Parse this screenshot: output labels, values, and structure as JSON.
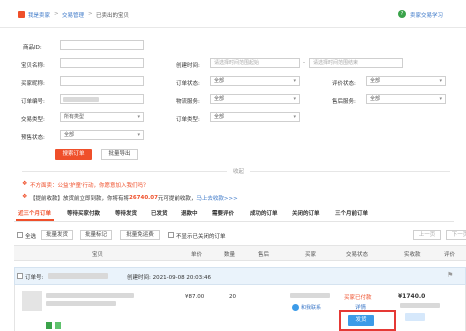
{
  "breadcrumb": {
    "home": "我是卖家",
    "section": "交易管理",
    "current": "已卖出的宝贝",
    "help": "卖家交易学习"
  },
  "filters": {
    "product_name_label": "商品ID:",
    "product_id_label": "宝贝名称:",
    "buyer_nick_label": "买家昵称:",
    "order_no_label": "订单编号:",
    "trade_type_label": "交易类型:",
    "trade_type_value": "所有类型",
    "presale_label": "预售状态:",
    "presale_value": "全部",
    "created_time_label": "创建时间:",
    "created_time_start_placeholder": "请选择时间范围起始",
    "created_time_end_placeholder": "请选择时间范围结束",
    "order_status_label": "订单状态:",
    "order_status_value": "全部",
    "logistics_label": "物流服务:",
    "logistics_value": "全部",
    "order_type_label": "订单类型:",
    "order_type_value": "全部",
    "review_status_label": "评价状态:",
    "review_status_value": "全部",
    "after_sale_label": "售后服务:",
    "after_sale_value": "全部",
    "search_button": "搜索订单",
    "export_button": "批量导出",
    "collapse": "收起"
  },
  "notices": {
    "line1": "不方面卖：公益'护童'行动，你愿意加入我们吗？",
    "line2_prefix": "【提前收款】放货前立即到款，你将有将",
    "line2_amount": "26740.07",
    "line2_suffix": "元可提前收款，",
    "line2_link": "马上去收款>>>"
  },
  "tabs": [
    "近三个月订单",
    "等待买家付款",
    "等待发货",
    "已发货",
    "退款中",
    "需要评价",
    "成功的订单",
    "关闭的订单",
    "三个月前订单"
  ],
  "bulk": {
    "select_all": "全选",
    "batch_ship": "批量发货",
    "batch_mark": "批量标记",
    "batch_free": "批量免运费",
    "hide_closed": "不显示已关闭的订单",
    "prev_page": "上一页",
    "next_page": "下一页"
  },
  "table": {
    "headers": [
      "宝贝",
      "单价",
      "数量",
      "售后",
      "买家",
      "交易状态",
      "实收款",
      "评价"
    ]
  },
  "order": {
    "order_label": "订单号:",
    "created_label": "创建时间: 2021-09-08 20:03:46",
    "price": "¥87.00",
    "qty": "20",
    "status": "买家已付款",
    "detail": "详情",
    "amount": "¥1740.0",
    "ship_button": "发货",
    "contact": "和我联系"
  },
  "colors": {
    "accent_red": "#ef4f2a",
    "link_blue": "#3c78c8",
    "amount_orange": "#f26c22",
    "tab_underline": "#ef4f2a"
  }
}
